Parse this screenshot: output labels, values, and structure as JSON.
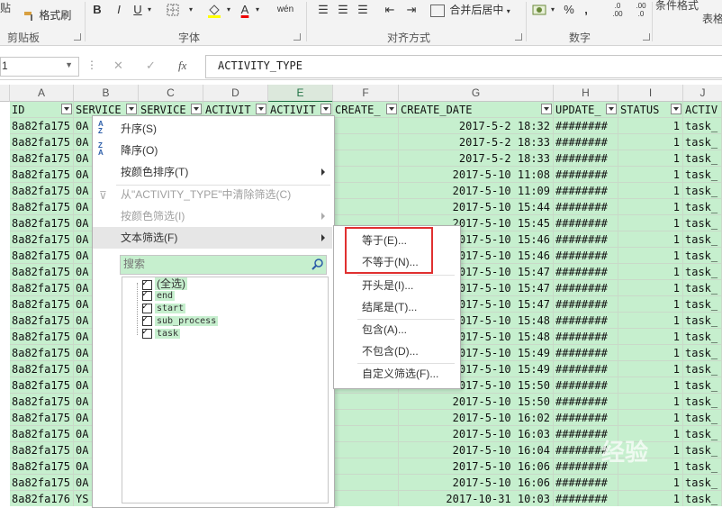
{
  "ribbon": {
    "format_painter": "格式刷",
    "groups": {
      "clipboard": "剪贴板",
      "font": "字体",
      "alignment": "对齐方式",
      "number": "数字"
    },
    "merge_center": "合并后居中",
    "conditional_format": "条件格式",
    "table_partial": "表格",
    "paste_partial": "贴",
    "bold": "B",
    "italic": "I",
    "underline": "U",
    "font_color_letter": "A",
    "pinyin": "wén",
    "percent": "%"
  },
  "formula_bar": {
    "name_box": "1",
    "cancel": "✕",
    "enter": "✓",
    "fx": "fx",
    "content": "ACTIVITY_TYPE"
  },
  "columns": [
    {
      "letter": "A",
      "header": "ID"
    },
    {
      "letter": "B",
      "header": "SERVICE"
    },
    {
      "letter": "C",
      "header": "SERVICE"
    },
    {
      "letter": "D",
      "header": "ACTIVIT"
    },
    {
      "letter": "E",
      "header": "ACTIVIT"
    },
    {
      "letter": "F",
      "header": "CREATE_"
    },
    {
      "letter": "G",
      "header": "CREATE_DATE"
    },
    {
      "letter": "H",
      "header": "UPDATE_"
    },
    {
      "letter": "I",
      "header": "STATUS"
    },
    {
      "letter": "J",
      "header": "ACTIV"
    }
  ],
  "rows": [
    {
      "id": "8a82fa175",
      "b": "0A",
      "create_date": "2017-5-2 18:32",
      "update": "########",
      "status": "1",
      "activ": "task_"
    },
    {
      "id": "8a82fa175",
      "b": "0A",
      "create_date": "2017-5-2 18:33",
      "update": "########",
      "status": "1",
      "activ": "task_"
    },
    {
      "id": "8a82fa175",
      "b": "0A",
      "create_date": "2017-5-2 18:33",
      "update": "########",
      "status": "1",
      "activ": "task_"
    },
    {
      "id": "8a82fa175",
      "b": "0A",
      "create_date": "2017-5-10 11:08",
      "update": "########",
      "status": "1",
      "activ": "task_"
    },
    {
      "id": "8a82fa175",
      "b": "0A",
      "create_date": "2017-5-10 11:09",
      "update": "########",
      "status": "1",
      "activ": "task_"
    },
    {
      "id": "8a82fa175",
      "b": "0A",
      "create_date": "2017-5-10 15:44",
      "update": "########",
      "status": "1",
      "activ": "task_"
    },
    {
      "id": "8a82fa175",
      "b": "0A",
      "create_date": "2017-5-10 15:45",
      "update": "########",
      "status": "1",
      "activ": "task_"
    },
    {
      "id": "8a82fa175",
      "b": "0A",
      "create_date": "2017-5-10 15:46",
      "update": "########",
      "status": "1",
      "activ": "task_"
    },
    {
      "id": "8a82fa175",
      "b": "0A",
      "create_date": "2017-5-10 15:46",
      "update": "########",
      "status": "1",
      "activ": "task_"
    },
    {
      "id": "8a82fa175",
      "b": "0A",
      "create_date": "2017-5-10 15:47",
      "update": "########",
      "status": "1",
      "activ": "task_"
    },
    {
      "id": "8a82fa175",
      "b": "0A",
      "create_date": "2017-5-10 15:47",
      "update": "########",
      "status": "1",
      "activ": "task_"
    },
    {
      "id": "8a82fa175",
      "b": "0A",
      "create_date": "2017-5-10 15:47",
      "update": "########",
      "status": "1",
      "activ": "task_"
    },
    {
      "id": "8a82fa175",
      "b": "0A",
      "create_date": "2017-5-10 15:48",
      "update": "########",
      "status": "1",
      "activ": "task_"
    },
    {
      "id": "8a82fa175",
      "b": "0A",
      "create_date": "2017-5-10 15:48",
      "update": "########",
      "status": "1",
      "activ": "task_"
    },
    {
      "id": "8a82fa175",
      "b": "0A",
      "create_date": "2017-5-10 15:49",
      "update": "########",
      "status": "1",
      "activ": "task_"
    },
    {
      "id": "8a82fa175",
      "b": "0A",
      "create_date": "2017-5-10 15:49",
      "update": "########",
      "status": "1",
      "activ": "task_"
    },
    {
      "id": "8a82fa175",
      "b": "0A",
      "create_date": "2017-5-10 15:50",
      "update": "########",
      "status": "1",
      "activ": "task_"
    },
    {
      "id": "8a82fa175",
      "b": "0A",
      "create_date": "2017-5-10 15:50",
      "update": "########",
      "status": "1",
      "activ": "task_"
    },
    {
      "id": "8a82fa175",
      "b": "0A",
      "create_date": "2017-5-10 16:02",
      "update": "########",
      "status": "1",
      "activ": "task_"
    },
    {
      "id": "8a82fa175",
      "b": "0A",
      "create_date": "2017-5-10 16:03",
      "update": "########",
      "status": "1",
      "activ": "task_"
    },
    {
      "id": "8a82fa175",
      "b": "0A",
      "create_date": "2017-5-10 16:04",
      "update": "########",
      "status": "1",
      "activ": "task_"
    },
    {
      "id": "8a82fa175",
      "b": "0A",
      "create_date": "2017-5-10 16:06",
      "update": "########",
      "status": "1",
      "activ": "task_"
    },
    {
      "id": "8a82fa175",
      "b": "0A",
      "create_date": "2017-5-10 16:06",
      "update": "########",
      "status": "1",
      "activ": "task_"
    },
    {
      "id": "8a82fa176",
      "b": "YS",
      "create_date": "2017-10-31 10:03",
      "update": "########",
      "status": "1",
      "activ": "task_"
    }
  ],
  "filter_menu": {
    "sort_asc": "升序(S)",
    "sort_desc": "降序(O)",
    "sort_by_color": "按颜色排序(T)",
    "clear_filter": "从\"ACTIVITY_TYPE\"中清除筛选(C)",
    "filter_by_color": "按颜色筛选(I)",
    "text_filter": "文本筛选(F)",
    "search_placeholder": "搜索",
    "items": [
      "(全选)",
      "end",
      "start",
      "sub_process",
      "task"
    ]
  },
  "text_filter_submenu": {
    "items": [
      "等于(E)...",
      "不等于(N)...",
      "开头是(I)...",
      "结尾是(T)...",
      "包含(A)...",
      "不包含(D)...",
      "自定义筛选(F)..."
    ]
  },
  "watermark": "经验",
  "colors": {
    "selection_green": "#c6efce",
    "excel_green": "#217346",
    "highlight_red": "#e03030"
  }
}
